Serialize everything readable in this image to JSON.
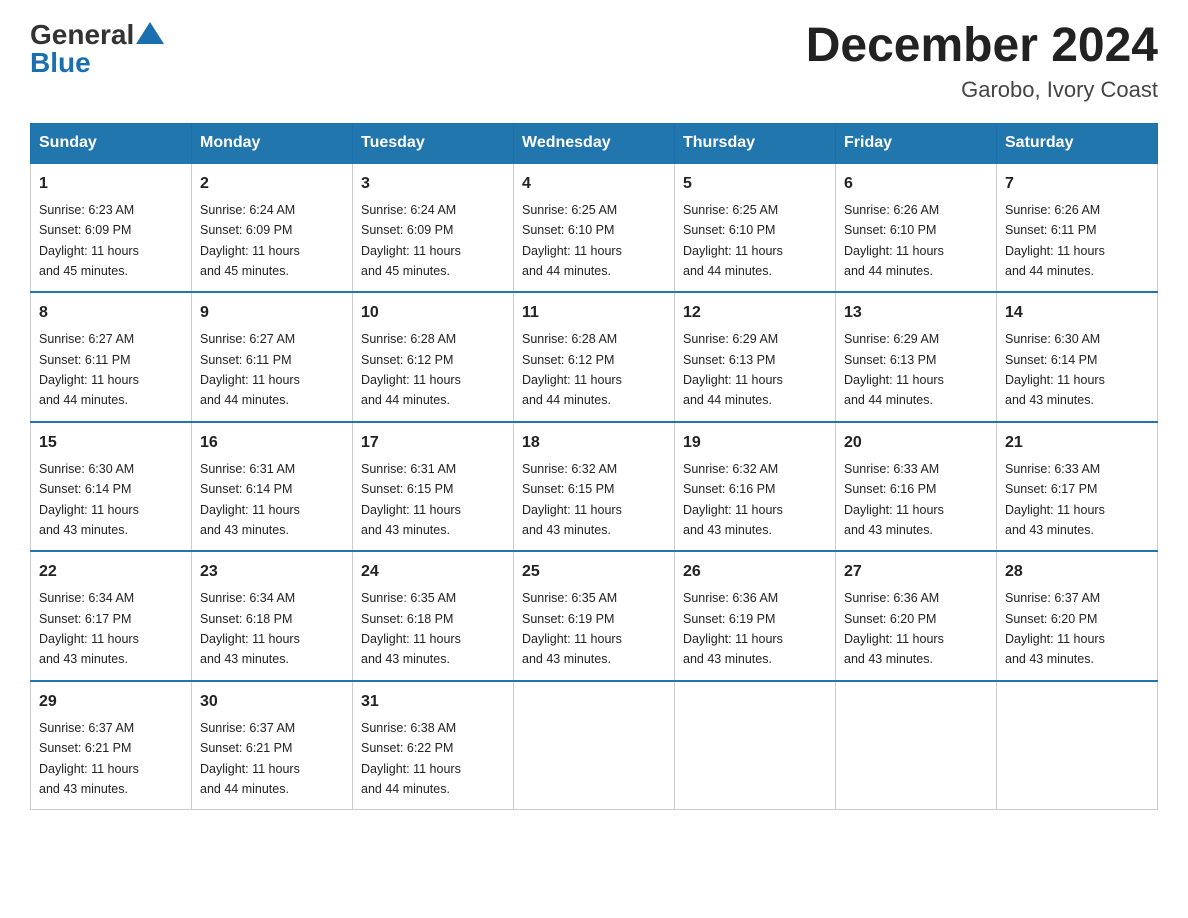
{
  "header": {
    "logo_general": "General",
    "logo_blue": "Blue",
    "month_title": "December 2024",
    "location": "Garobo, Ivory Coast"
  },
  "days_of_week": [
    "Sunday",
    "Monday",
    "Tuesday",
    "Wednesday",
    "Thursday",
    "Friday",
    "Saturday"
  ],
  "weeks": [
    [
      {
        "day": "1",
        "sunrise": "6:23 AM",
        "sunset": "6:09 PM",
        "daylight": "11 hours and 45 minutes."
      },
      {
        "day": "2",
        "sunrise": "6:24 AM",
        "sunset": "6:09 PM",
        "daylight": "11 hours and 45 minutes."
      },
      {
        "day": "3",
        "sunrise": "6:24 AM",
        "sunset": "6:09 PM",
        "daylight": "11 hours and 45 minutes."
      },
      {
        "day": "4",
        "sunrise": "6:25 AM",
        "sunset": "6:10 PM",
        "daylight": "11 hours and 44 minutes."
      },
      {
        "day": "5",
        "sunrise": "6:25 AM",
        "sunset": "6:10 PM",
        "daylight": "11 hours and 44 minutes."
      },
      {
        "day": "6",
        "sunrise": "6:26 AM",
        "sunset": "6:10 PM",
        "daylight": "11 hours and 44 minutes."
      },
      {
        "day": "7",
        "sunrise": "6:26 AM",
        "sunset": "6:11 PM",
        "daylight": "11 hours and 44 minutes."
      }
    ],
    [
      {
        "day": "8",
        "sunrise": "6:27 AM",
        "sunset": "6:11 PM",
        "daylight": "11 hours and 44 minutes."
      },
      {
        "day": "9",
        "sunrise": "6:27 AM",
        "sunset": "6:11 PM",
        "daylight": "11 hours and 44 minutes."
      },
      {
        "day": "10",
        "sunrise": "6:28 AM",
        "sunset": "6:12 PM",
        "daylight": "11 hours and 44 minutes."
      },
      {
        "day": "11",
        "sunrise": "6:28 AM",
        "sunset": "6:12 PM",
        "daylight": "11 hours and 44 minutes."
      },
      {
        "day": "12",
        "sunrise": "6:29 AM",
        "sunset": "6:13 PM",
        "daylight": "11 hours and 44 minutes."
      },
      {
        "day": "13",
        "sunrise": "6:29 AM",
        "sunset": "6:13 PM",
        "daylight": "11 hours and 44 minutes."
      },
      {
        "day": "14",
        "sunrise": "6:30 AM",
        "sunset": "6:14 PM",
        "daylight": "11 hours and 43 minutes."
      }
    ],
    [
      {
        "day": "15",
        "sunrise": "6:30 AM",
        "sunset": "6:14 PM",
        "daylight": "11 hours and 43 minutes."
      },
      {
        "day": "16",
        "sunrise": "6:31 AM",
        "sunset": "6:14 PM",
        "daylight": "11 hours and 43 minutes."
      },
      {
        "day": "17",
        "sunrise": "6:31 AM",
        "sunset": "6:15 PM",
        "daylight": "11 hours and 43 minutes."
      },
      {
        "day": "18",
        "sunrise": "6:32 AM",
        "sunset": "6:15 PM",
        "daylight": "11 hours and 43 minutes."
      },
      {
        "day": "19",
        "sunrise": "6:32 AM",
        "sunset": "6:16 PM",
        "daylight": "11 hours and 43 minutes."
      },
      {
        "day": "20",
        "sunrise": "6:33 AM",
        "sunset": "6:16 PM",
        "daylight": "11 hours and 43 minutes."
      },
      {
        "day": "21",
        "sunrise": "6:33 AM",
        "sunset": "6:17 PM",
        "daylight": "11 hours and 43 minutes."
      }
    ],
    [
      {
        "day": "22",
        "sunrise": "6:34 AM",
        "sunset": "6:17 PM",
        "daylight": "11 hours and 43 minutes."
      },
      {
        "day": "23",
        "sunrise": "6:34 AM",
        "sunset": "6:18 PM",
        "daylight": "11 hours and 43 minutes."
      },
      {
        "day": "24",
        "sunrise": "6:35 AM",
        "sunset": "6:18 PM",
        "daylight": "11 hours and 43 minutes."
      },
      {
        "day": "25",
        "sunrise": "6:35 AM",
        "sunset": "6:19 PM",
        "daylight": "11 hours and 43 minutes."
      },
      {
        "day": "26",
        "sunrise": "6:36 AM",
        "sunset": "6:19 PM",
        "daylight": "11 hours and 43 minutes."
      },
      {
        "day": "27",
        "sunrise": "6:36 AM",
        "sunset": "6:20 PM",
        "daylight": "11 hours and 43 minutes."
      },
      {
        "day": "28",
        "sunrise": "6:37 AM",
        "sunset": "6:20 PM",
        "daylight": "11 hours and 43 minutes."
      }
    ],
    [
      {
        "day": "29",
        "sunrise": "6:37 AM",
        "sunset": "6:21 PM",
        "daylight": "11 hours and 43 minutes."
      },
      {
        "day": "30",
        "sunrise": "6:37 AM",
        "sunset": "6:21 PM",
        "daylight": "11 hours and 44 minutes."
      },
      {
        "day": "31",
        "sunrise": "6:38 AM",
        "sunset": "6:22 PM",
        "daylight": "11 hours and 44 minutes."
      },
      null,
      null,
      null,
      null
    ]
  ],
  "sunrise_label": "Sunrise:",
  "sunset_label": "Sunset:",
  "daylight_label": "Daylight:"
}
